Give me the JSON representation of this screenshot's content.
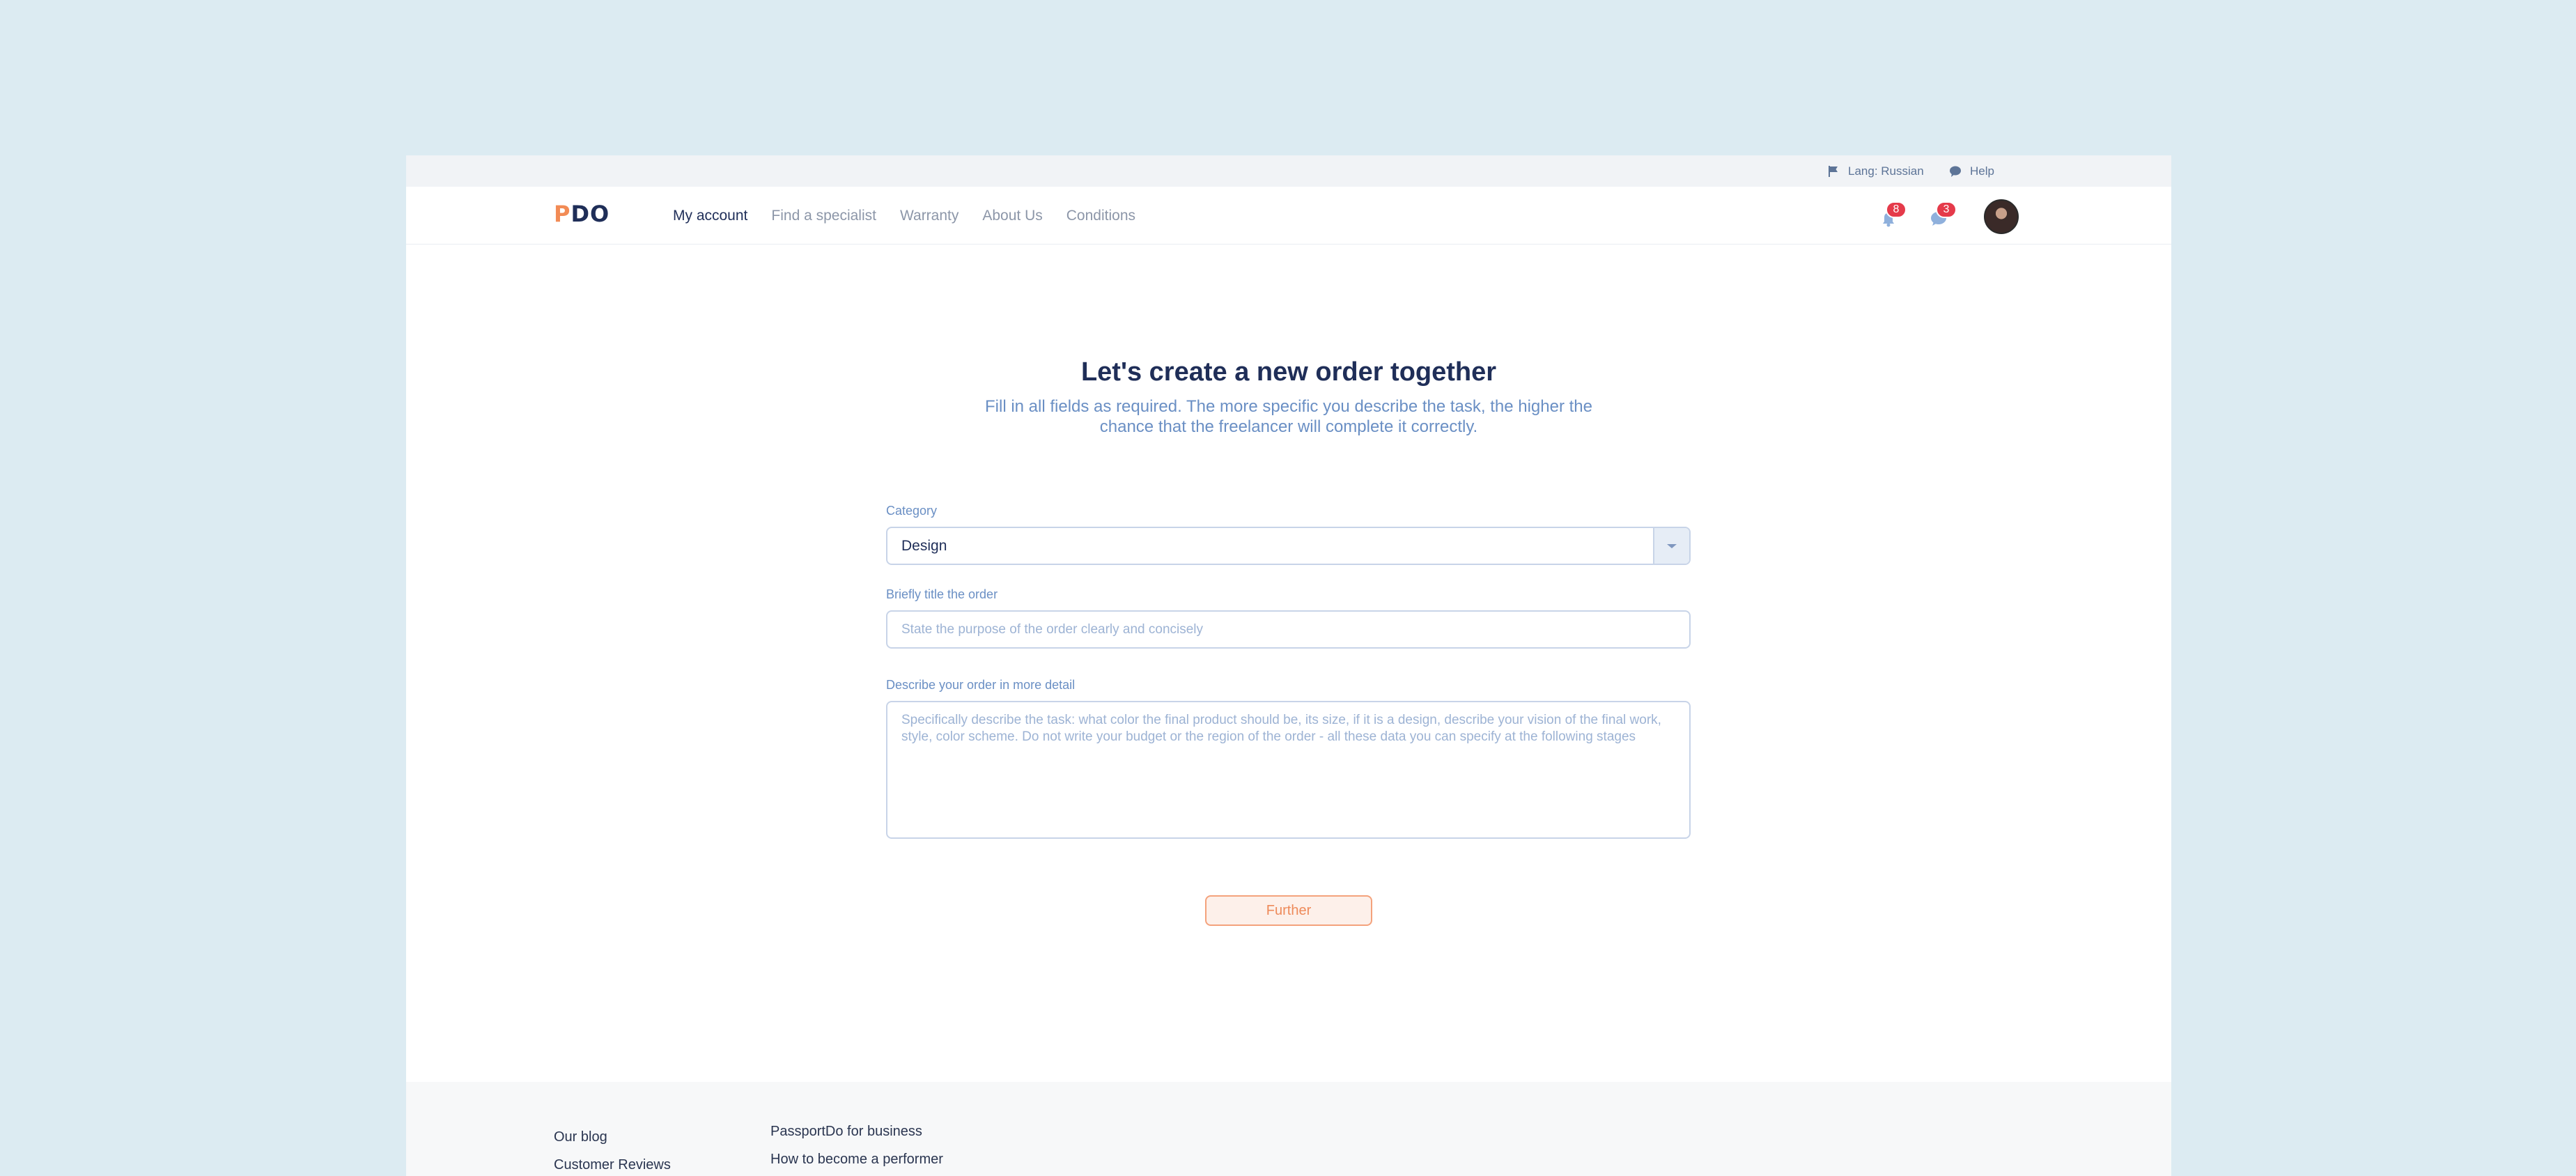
{
  "topbar": {
    "lang_label": "Lang: Russian",
    "help_label": "Help"
  },
  "nav": {
    "logo_p": "P",
    "logo_rest": "DO",
    "links": [
      "My account",
      "Find a specialist",
      "Warranty",
      "About Us",
      "Conditions"
    ],
    "notifications_count": "8",
    "messages_count": "3"
  },
  "main": {
    "title": "Let's create a new order together",
    "subtitle": "Fill in all fields as required. The more specific you describe the task, the higher the chance that the freelancer will complete it correctly.",
    "category_label": "Category",
    "category_value": "Design",
    "title_field_label": "Briefly title the order",
    "title_field_placeholder": "State the purpose of the order clearly and concisely",
    "description_label": "Describe your order in more detail",
    "description_placeholder": "Specifically describe the task: what color the final product should be, its size, if it is a design, describe your vision of the final work, style, color scheme. Do not write your budget or the region of the order - all these data you can specify at the following stages",
    "further_label": "Further"
  },
  "footer": {
    "col1": [
      "Our blog",
      "Customer Reviews"
    ],
    "col2": [
      "PassportDo for business",
      "How to become a performer"
    ]
  },
  "colors": {
    "background": "#dcebf2",
    "accent": "#ee8a5a",
    "primary_text": "#1f2e58",
    "secondary_text": "#6a8fc4",
    "badge": "#e53a4a"
  }
}
